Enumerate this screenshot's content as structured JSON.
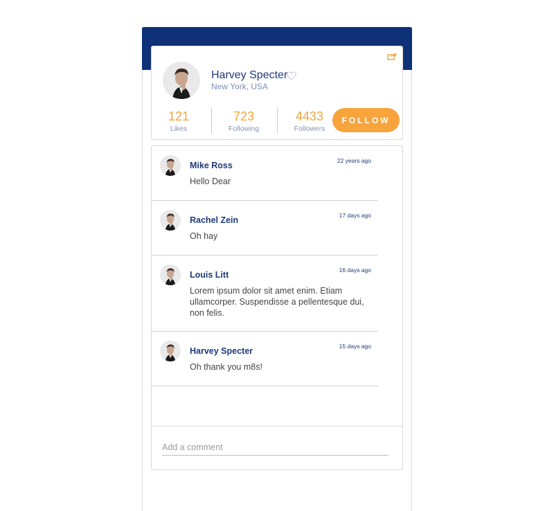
{
  "profile": {
    "name": "Harvey Specter",
    "location": "New York, USA",
    "stats": [
      {
        "value": "121",
        "label": "Likes"
      },
      {
        "value": "723",
        "label": "Following"
      },
      {
        "value": "4433",
        "label": "Followers"
      }
    ],
    "follow_label": "FOLLOW"
  },
  "comments": [
    {
      "author": "Mike Ross",
      "time": "22 years ago",
      "text": "Hello Dear"
    },
    {
      "author": "Rachel Zein",
      "time": "17 days ago",
      "text": "Oh hay"
    },
    {
      "author": "Louis Litt",
      "time": "16 days ago",
      "text": "Lorem ipsum dolor sit amet enim. Etiam ullamcorper. Suspendisse a pellentesque dui, non felis."
    },
    {
      "author": "Harvey Specter",
      "time": "15 days ago",
      "text": "Oh thank you m8s!"
    }
  ],
  "comment_input": {
    "placeholder": "Add a comment"
  },
  "icons": {
    "share": "share-icon",
    "like": "heart-icon"
  },
  "colors": {
    "header": "#0f3177",
    "accent": "#f7a43c",
    "name": "#1e3a78"
  }
}
